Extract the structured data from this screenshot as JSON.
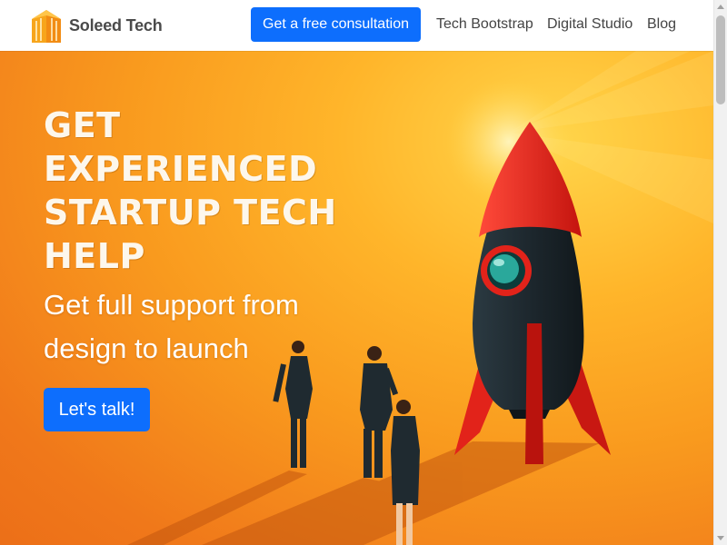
{
  "navbar": {
    "brand_name": "Soleed Tech",
    "logo_icon": "building-logo-icon",
    "cta_label": "Get a free consultation",
    "links": [
      "Tech Bootstrap",
      "Digital Studio",
      "Blog"
    ]
  },
  "hero": {
    "headline_lines": [
      "Get",
      "Experienced",
      "Startup Tech",
      "Help"
    ],
    "subheadline": "Get full support from design to launch",
    "button_label": "Let's talk!",
    "illustration": "rocket-and-businesspeople-illustration"
  },
  "colors": {
    "primary_button": "#0d6efd",
    "hero_orange": "#f99a1e",
    "hero_yellow": "#ffd54a",
    "rocket_red": "#e2231a",
    "rocket_body": "#1f2b33"
  }
}
